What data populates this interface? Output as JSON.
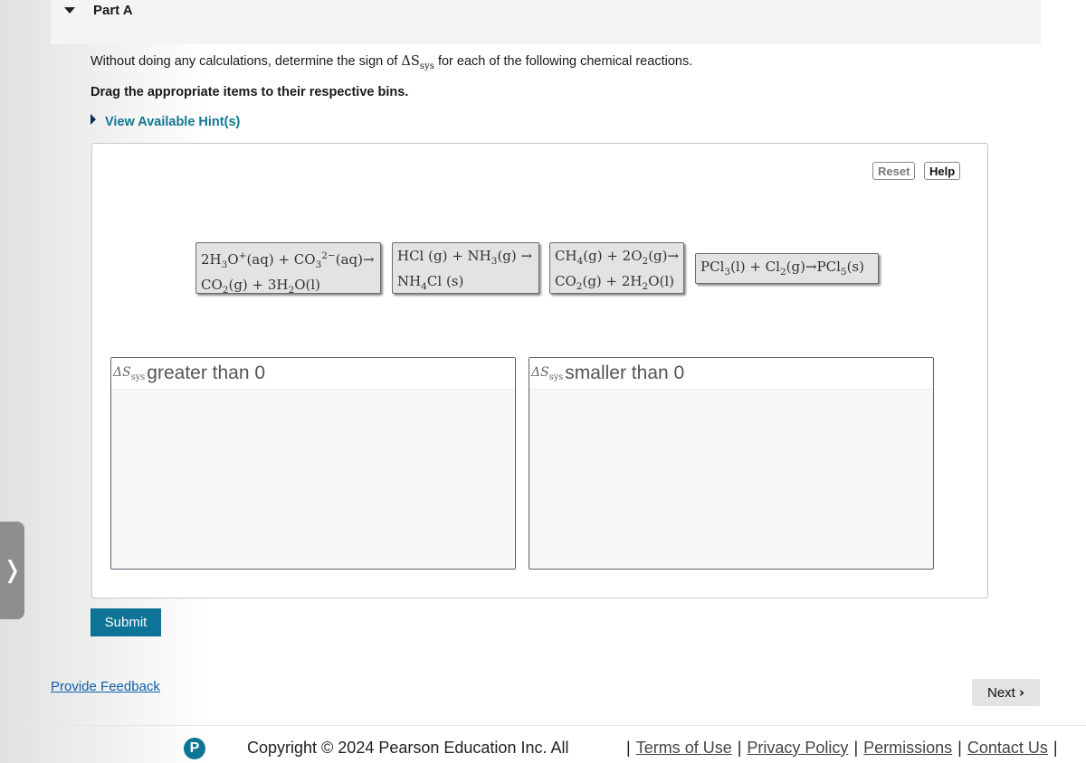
{
  "part": {
    "title": "Part A"
  },
  "question": {
    "prefix": "Without doing any calculations, determine the sign of",
    "symbol_main": "ΔS",
    "symbol_sub": "sys",
    "suffix": "for each of the following chemical reactions."
  },
  "instruction": "Drag the appropriate items to their respective bins.",
  "hint_link": "View Available Hint(s)",
  "toolbar": {
    "reset_label": "Reset",
    "help_label": "Help"
  },
  "bins": [
    {
      "symbol_main": "ΔS",
      "symbol_sub": "sys",
      "label": "greater than 0"
    },
    {
      "symbol_main": "ΔS",
      "symbol_sub": "sys",
      "label": "smaller than 0"
    }
  ],
  "reactions": [
    {
      "line1": [
        "2H",
        "3",
        "O",
        "+",
        "(aq) + CO",
        "3",
        "2−",
        "(aq)→"
      ],
      "line2": [
        "CO",
        "2",
        "(g) + 3H",
        "2",
        "O(l)"
      ]
    },
    {
      "line1": [
        "HCl (g) + NH",
        "3",
        "(g) →"
      ],
      "line2": [
        "NH",
        "4",
        "Cl (s)"
      ]
    },
    {
      "line1": [
        "CH",
        "4",
        "(g) + 2O",
        "2",
        "(g)→"
      ],
      "line2": [
        "CO",
        "2",
        "(g) + 2H",
        "2",
        "O(l)"
      ]
    },
    {
      "line1": [
        "PCl",
        "3",
        "(l) + Cl",
        "2",
        "(g)→PCl",
        "5",
        "(s)"
      ]
    }
  ],
  "submit_label": "Submit",
  "feedback_link": "Provide Feedback",
  "next_label": "Next",
  "footer": {
    "copyright": "Copyright © 2024  Pearson Education Inc. All",
    "logo_letter": "P",
    "links": [
      "Terms of Use",
      "Privacy Policy",
      "Permissions",
      "Contact Us"
    ]
  },
  "side_tab_glyph": "❭",
  "colors": {
    "accent": "#0d7397",
    "link": "#0d5ea8",
    "hint": "#0d7890"
  },
  "icons": {
    "part_toggle": "caret-down-icon",
    "hint_toggle": "caret-right-icon",
    "next": "chevron-right-icon",
    "side_tab": "chevron-right-icon"
  }
}
